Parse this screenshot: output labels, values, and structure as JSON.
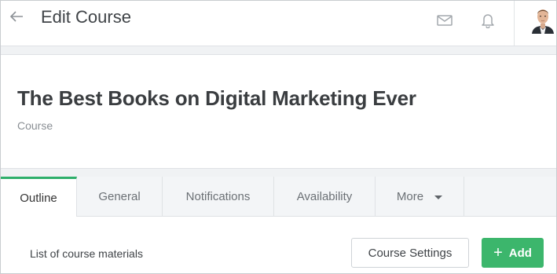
{
  "topbar": {
    "title": "Edit Course",
    "back_icon": "arrow-left-icon",
    "mail_icon": "mail-icon",
    "bell_icon": "bell-icon",
    "avatar": "user-avatar"
  },
  "header": {
    "course_title": "The Best Books on Digital Marketing Ever",
    "course_type": "Course"
  },
  "tabs": [
    {
      "label": "Outline",
      "active": true
    },
    {
      "label": "General",
      "active": false
    },
    {
      "label": "Notifications",
      "active": false
    },
    {
      "label": "Availability",
      "active": false
    },
    {
      "label": "More",
      "active": false
    }
  ],
  "content": {
    "list_label": "List of course materials",
    "settings_button": "Course Settings",
    "add_button": "Add"
  },
  "colors": {
    "accent": "#3cb66c",
    "tab_active_border": "#2eaf6b"
  }
}
